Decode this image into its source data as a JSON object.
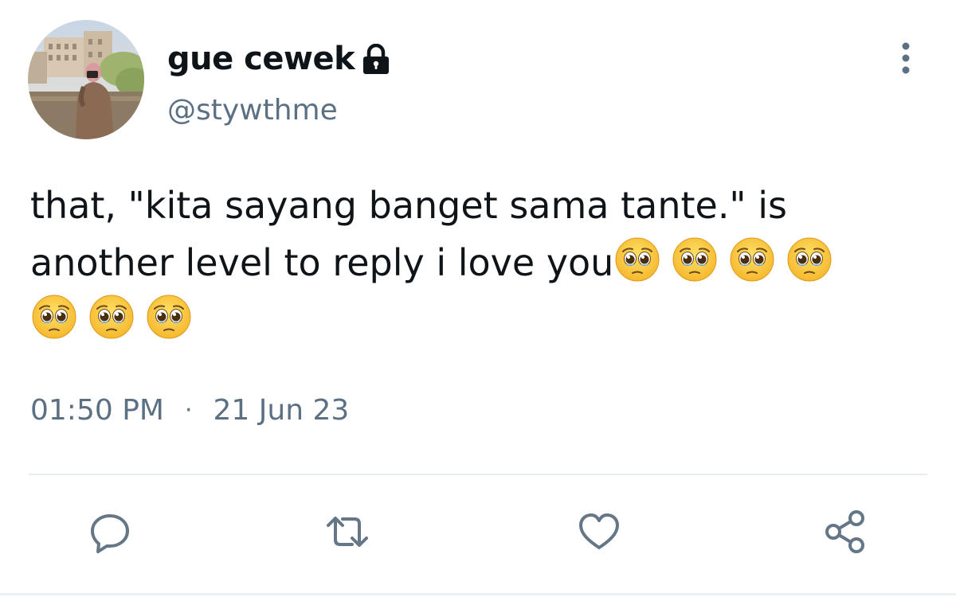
{
  "user": {
    "display_name": "gue cewek",
    "handle": "@stywthme",
    "protected_icon": "lock-icon",
    "avatar": "profile-photo"
  },
  "tweet": {
    "line1": "that, \"kita sayang banget sama tante.\" is",
    "line2": "another level to reply i love you",
    "emojis": [
      "🥺",
      "🥺",
      "🥺",
      "🥺",
      "🥺",
      "🥺",
      "🥺"
    ],
    "time": "01:50 PM",
    "separator": "·",
    "date": "21 Jun 23"
  },
  "actions": {
    "reply_icon": "reply-icon",
    "retweet_icon": "retweet-icon",
    "like_icon": "heart-icon",
    "share_icon": "share-icon",
    "more_icon": "more-vertical-icon"
  },
  "colors": {
    "text": "#0f1419",
    "secondary": "#5b7083",
    "divider": "#e6ecf0",
    "icon": "#657786"
  }
}
